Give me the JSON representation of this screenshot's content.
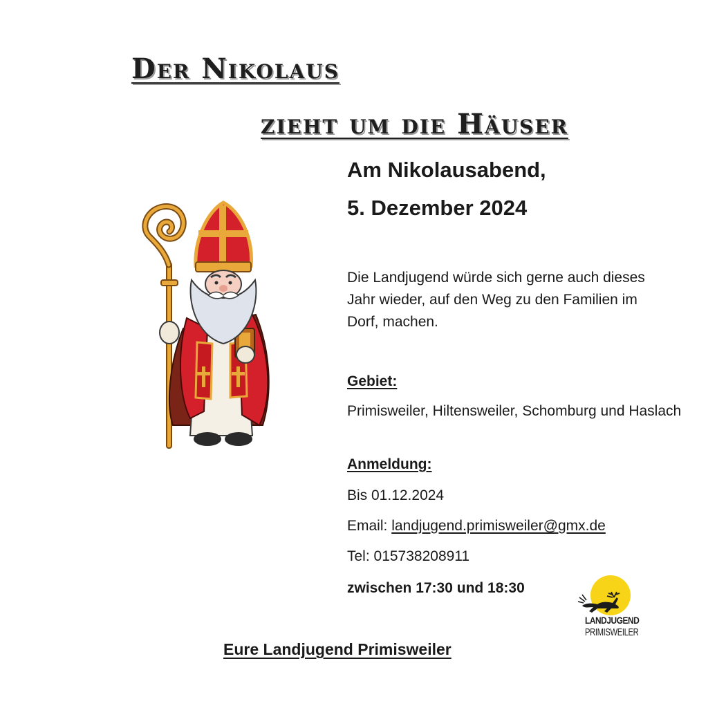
{
  "title": {
    "line1": "Der Nikolaus",
    "line2": "zieht um die Häuser"
  },
  "event": {
    "date_line1": "Am Nikolausabend,",
    "date_line2": "5. Dezember 2024"
  },
  "intro": "Die Landjugend würde sich gerne auch dieses Jahr wieder, auf den Weg zu den Familien im Dorf, machen.",
  "area": {
    "heading": "Gebiet:",
    "text": "Primisweiler, Hiltensweiler, Schomburg und Haslach"
  },
  "registration": {
    "heading": "Anmeldung:",
    "deadline": "Bis 01.12.2024",
    "email_label": "Email: ",
    "email": "landjugend.primisweiler@gmx.de",
    "phone": "Tel: 015738208911",
    "time": "zwischen 17:30 und 18:30"
  },
  "footer": "Eure Landjugend Primisweiler",
  "logo": {
    "line1": "LANDJUGEND",
    "line2": "PRIMISWEILER",
    "color": "#f7d417"
  },
  "illustration": {
    "icon": "saint-nicholas-icon",
    "robe_color": "#d4202a",
    "gold_color": "#e8a93a"
  }
}
